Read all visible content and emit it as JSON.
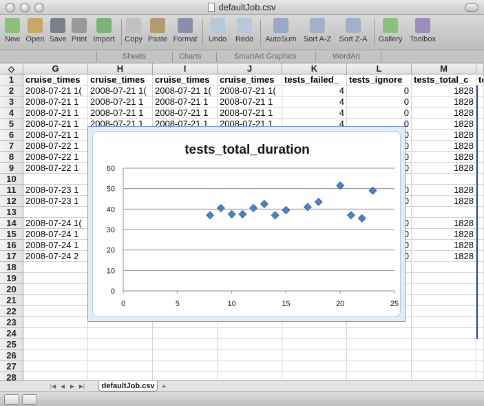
{
  "window": {
    "title": "defaultJob.csv"
  },
  "toolbar": {
    "items": [
      "New",
      "Open",
      "Save",
      "Print",
      "Import",
      "Copy",
      "Paste",
      "Format",
      "Undo",
      "Redo",
      "AutoSum",
      "Sort A-Z",
      "Sort Z-A",
      "Gallery",
      "Toolbox"
    ]
  },
  "ribbon": {
    "tabs": [
      "Sheets",
      "Charts",
      "SmartArt Graphics",
      "WordArt"
    ]
  },
  "sheet": {
    "corner_icon": "select-all-icon",
    "columns": [
      "G",
      "H",
      "I",
      "J",
      "K",
      "L",
      "M"
    ],
    "rows": [
      {
        "n": "1",
        "cells": [
          "cruise_times",
          "cruise_times",
          "cruise_times",
          "cruise_times",
          "tests_failed_",
          "tests_ignore",
          "tests_total_c",
          "te"
        ]
      },
      {
        "n": "2",
        "cells": [
          "2008-07-21 1(",
          "2008-07-21 1(",
          "2008-07-21 1(",
          "2008-07-21 1(",
          "4",
          "0",
          "1828",
          ""
        ]
      },
      {
        "n": "3",
        "cells": [
          "2008-07-21 1",
          "2008-07-21 1",
          "2008-07-21 1",
          "2008-07-21 1",
          "4",
          "0",
          "1828",
          ""
        ]
      },
      {
        "n": "4",
        "cells": [
          "2008-07-21 1",
          "2008-07-21 1",
          "2008-07-21 1",
          "2008-07-21 1",
          "4",
          "0",
          "1828",
          ""
        ]
      },
      {
        "n": "5",
        "cells": [
          "2008-07-21 1",
          "2008-07-21 1",
          "2008-07-21 1",
          "2008-07-21 1",
          "4",
          "0",
          "1828",
          ""
        ]
      },
      {
        "n": "6",
        "cells": [
          "2008-07-21 1",
          "",
          "",
          "",
          "",
          "0",
          "1828",
          ""
        ]
      },
      {
        "n": "7",
        "cells": [
          "2008-07-22 1",
          "",
          "",
          "",
          "",
          "0",
          "1828",
          ""
        ]
      },
      {
        "n": "8",
        "cells": [
          "2008-07-22 1",
          "",
          "",
          "",
          "",
          "0",
          "1828",
          ""
        ]
      },
      {
        "n": "9",
        "cells": [
          "2008-07-22 1",
          "",
          "",
          "",
          "",
          "0",
          "1828",
          ""
        ]
      },
      {
        "n": "10",
        "cells": [
          "",
          "",
          "",
          "",
          "",
          "",
          "",
          ""
        ]
      },
      {
        "n": "11",
        "cells": [
          "2008-07-23 1",
          "",
          "",
          "",
          "",
          "0",
          "1828",
          ""
        ]
      },
      {
        "n": "12",
        "cells": [
          "2008-07-23 1",
          "",
          "",
          "",
          "",
          "0",
          "1828",
          ""
        ]
      },
      {
        "n": "13",
        "cells": [
          "",
          "",
          "",
          "",
          "",
          "",
          "",
          ""
        ]
      },
      {
        "n": "14",
        "cells": [
          "2008-07-24 1(",
          "",
          "",
          "",
          "",
          "0",
          "1828",
          ""
        ]
      },
      {
        "n": "15",
        "cells": [
          "2008-07-24 1",
          "",
          "",
          "",
          "",
          "0",
          "1828",
          ""
        ]
      },
      {
        "n": "16",
        "cells": [
          "2008-07-24 1",
          "",
          "",
          "",
          "",
          "0",
          "1828",
          ""
        ]
      },
      {
        "n": "17",
        "cells": [
          "2008-07-24 2",
          "",
          "",
          "",
          "",
          "0",
          "1828",
          ""
        ]
      },
      {
        "n": "18",
        "cells": [
          "",
          "",
          "",
          "",
          "",
          "",
          "",
          ""
        ]
      },
      {
        "n": "19",
        "cells": [
          "",
          "",
          "",
          "",
          "",
          "",
          "",
          ""
        ]
      },
      {
        "n": "20",
        "cells": [
          "",
          "",
          "",
          "",
          "",
          "",
          "",
          ""
        ]
      },
      {
        "n": "21",
        "cells": [
          "",
          "",
          "",
          "",
          "",
          "",
          "",
          ""
        ]
      },
      {
        "n": "22",
        "cells": [
          "",
          "",
          "",
          "",
          "",
          "",
          "",
          ""
        ]
      },
      {
        "n": "23",
        "cells": [
          "",
          "",
          "",
          "",
          "",
          "",
          "",
          ""
        ]
      },
      {
        "n": "24",
        "cells": [
          "",
          "",
          "",
          "",
          "",
          "",
          "",
          ""
        ]
      },
      {
        "n": "25",
        "cells": [
          "",
          "",
          "",
          "",
          "",
          "",
          "",
          ""
        ]
      },
      {
        "n": "26",
        "cells": [
          "",
          "",
          "",
          "",
          "",
          "",
          "",
          ""
        ]
      },
      {
        "n": "27",
        "cells": [
          "",
          "",
          "",
          "",
          "",
          "",
          "",
          ""
        ]
      },
      {
        "n": "28",
        "cells": [
          "",
          "",
          "",
          "",
          "",
          "",
          "",
          ""
        ]
      }
    ]
  },
  "sheet_tabs": {
    "active": "defaultJob.csv",
    "add_label": "+"
  },
  "chart_data": {
    "type": "scatter",
    "title": "tests_total_duration",
    "xlim": [
      0,
      25
    ],
    "ylim": [
      0,
      60
    ],
    "xticks": [
      "0",
      "5",
      "10",
      "15",
      "20",
      "25"
    ],
    "yticks": [
      "0",
      "10",
      "20",
      "30",
      "40",
      "50",
      "60"
    ],
    "grid": "horizontal",
    "marker_color": "#4f81bd",
    "x": [
      8,
      9,
      10,
      11,
      12,
      13,
      14,
      15,
      17,
      18,
      20,
      21,
      22,
      23
    ],
    "y": [
      37,
      40.5,
      37.5,
      37.5,
      40.5,
      42.5,
      37,
      39.5,
      41,
      43.5,
      51.5,
      37,
      35.5,
      49
    ]
  }
}
